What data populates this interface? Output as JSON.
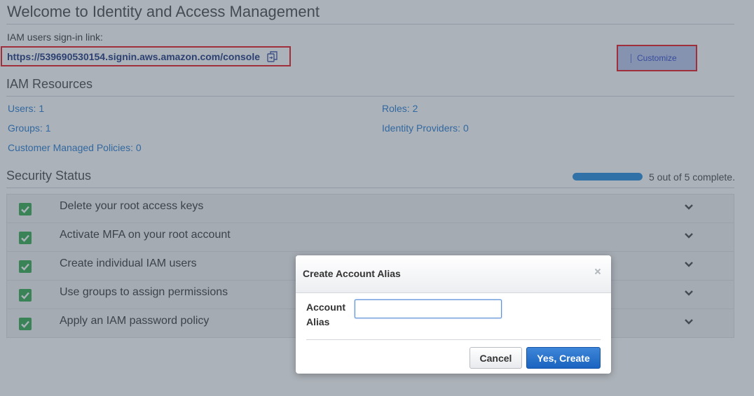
{
  "header": {
    "title": "Welcome to Identity and Access Management"
  },
  "signin": {
    "label": "IAM users sign-in link:",
    "url": "https://539690530154.signin.aws.amazon.com/console",
    "customize_label": "Customize"
  },
  "resources": {
    "title": "IAM Resources",
    "items": [
      {
        "label": "Users: 1"
      },
      {
        "label": "Roles: 2"
      },
      {
        "label": "Groups: 1"
      },
      {
        "label": "Identity Providers: 0"
      },
      {
        "label": "Customer Managed Policies: 0"
      }
    ]
  },
  "security": {
    "title": "Security Status",
    "progress_fraction": 1.0,
    "progress_text": "5 out of 5 complete.",
    "items": [
      {
        "label": "Delete your root access keys"
      },
      {
        "label": "Activate MFA on your root account"
      },
      {
        "label": "Create individual IAM users"
      },
      {
        "label": "Use groups to assign permissions"
      },
      {
        "label": "Apply an IAM password policy"
      }
    ]
  },
  "modal": {
    "title": "Create Account Alias",
    "field_label": "Account Alias",
    "field_value": "",
    "cancel_label": "Cancel",
    "confirm_label": "Yes, Create"
  },
  "colors": {
    "link": "#1f78d1",
    "check": "#2ea94d",
    "primary_button": "#1a63c0",
    "highlight_border": "#e8131b"
  }
}
